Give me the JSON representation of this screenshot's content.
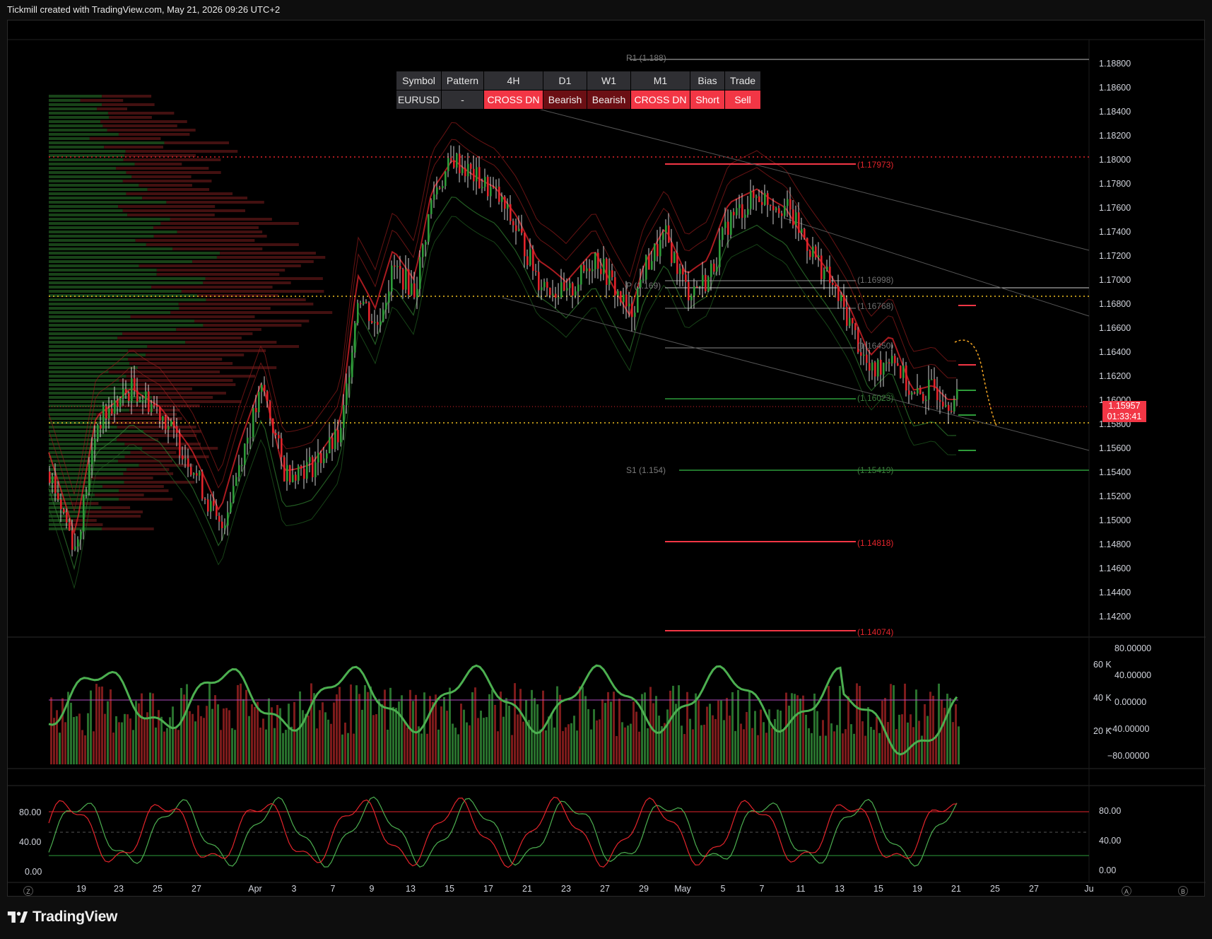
{
  "header": {
    "title": "Tickmill created with TradingView.com, May 21, 2026 09:26 UTC+2"
  },
  "footer": {
    "brand": "TradingView"
  },
  "table": {
    "headers": [
      "Symbol",
      "Pattern",
      "4H",
      "D1",
      "W1",
      "M1",
      "Bias",
      "Trade"
    ],
    "values": [
      "EURUSD",
      "-",
      "CROSS DN",
      "Bearish",
      "Bearish",
      "CROSS DN",
      "Short",
      "Sell"
    ]
  },
  "price_axis": {
    "labels": [
      "1.18800",
      "1.18600",
      "1.18400",
      "1.18200",
      "1.18000",
      "1.17800",
      "1.17600",
      "1.17400",
      "1.17200",
      "1.17000",
      "1.16800",
      "1.16600",
      "1.16400",
      "1.16200",
      "1.16000",
      "1.15800",
      "1.15600",
      "1.15400",
      "1.15200",
      "1.15000",
      "1.14800",
      "1.14600",
      "1.14400",
      "1.14200"
    ],
    "current_price": "1.15957",
    "countdown": "01:33:41"
  },
  "level_labels": {
    "r1": "R1 (1.188)",
    "p": "P (1.169)",
    "s1": "S1 (1.154)",
    "l1": "(1.17973)",
    "l2": "(1.16998)",
    "l3": "(1.16768)",
    "l4": "(1.16450)",
    "l5": "(1.16023)",
    "l6": "(1.15419)",
    "l7": "(1.14818)",
    "l8": "(1.14074)"
  },
  "volume_axis": {
    "left_labels": [
      "60 K",
      "40 K",
      "20 K"
    ],
    "right_labels": [
      "80.00000",
      "40.00000",
      "0.00000",
      "−40.00000",
      "−80.00000"
    ]
  },
  "stoch_axis": {
    "left_labels": [
      "80.00",
      "40.00",
      "0.00"
    ],
    "right_labels": [
      "80.00",
      "40.00",
      "0.00"
    ]
  },
  "time_axis": {
    "labels": [
      "19",
      "23",
      "25",
      "27",
      "Apr",
      "3",
      "7",
      "9",
      "13",
      "15",
      "17",
      "21",
      "23",
      "27",
      "29",
      "May",
      "5",
      "7",
      "11",
      "13",
      "15",
      "19",
      "21",
      "25",
      "27",
      "Ju"
    ],
    "left_button": "Z",
    "right_buttons": [
      "A",
      "B"
    ]
  },
  "colors": {
    "bull": "#2e9c3a",
    "bear": "#e3242b",
    "accent_red": "#f23645",
    "background": "#000000"
  }
}
